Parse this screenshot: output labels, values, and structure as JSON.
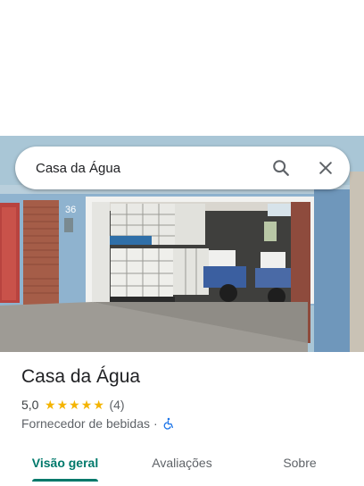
{
  "search": {
    "query": "Casa da Água",
    "search_icon": "search-icon",
    "close_icon": "close-icon"
  },
  "photo": {
    "house_number": "36"
  },
  "place": {
    "name": "Casa da Água",
    "rating_value": "5,0",
    "stars": 5,
    "review_count": "(4)",
    "category": "Fornecedor de bebidas",
    "separator": "·",
    "accessibility_icon": "wheelchair-accessible-icon"
  },
  "tabs": [
    {
      "label": "Visão geral",
      "active": true
    },
    {
      "label": "Avaliações",
      "active": false
    },
    {
      "label": "Sobre",
      "active": false
    }
  ],
  "colors": {
    "accent": "#00796b",
    "star": "#f4b400",
    "accessibility": "#1a73e8"
  }
}
